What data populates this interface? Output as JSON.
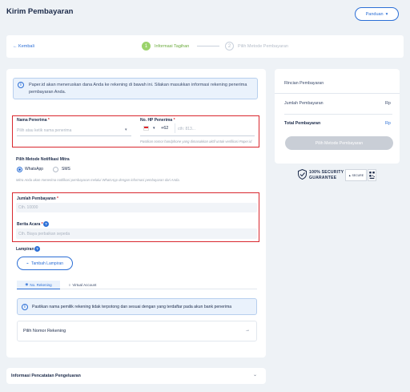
{
  "header": {
    "title": "Kirim Pembayaran",
    "guide_label": "Panduan"
  },
  "stepper": {
    "back_label": "Kembali",
    "steps": [
      {
        "number": "1",
        "label": "Informasi Tagihan"
      },
      {
        "number": "2",
        "label": "Pilih Metode Pembayaran"
      }
    ]
  },
  "info_banner": {
    "text": "Paper.id akan meneruskan dana Anda ke rekening di bawah ini. Silakan masukkan informasi rekening penerima pembayaran Anda."
  },
  "recipient": {
    "name_label": "Nama Penerima",
    "name_placeholder": "Pilih atau ketik nama penerima",
    "phone_label": "No. HP Penerima",
    "country_code": "+62",
    "phone_placeholder": "cth: 813...",
    "phone_hint": "Pastikan nomor handphone yang dimasukkan aktif untuk verifikasi Paper.id"
  },
  "notification": {
    "label": "Pilih Metode Notifikasi Mitra",
    "options": [
      "WhatsApp",
      "SMS"
    ],
    "selected": "WhatsApp",
    "hint": "Mitra Anda akan menerima notifikasi pembayaran melalui WhatsApp dengan informasi pembayaran dari Anda."
  },
  "payment": {
    "amount_label": "Jumlah Pembayaran",
    "amount_placeholder": "Cth. 10000",
    "news_label": "Berita Acara",
    "news_placeholder": "Cth. Biaya perbaikan sepeda"
  },
  "attachment": {
    "label": "Lampiran",
    "button_label": "Tambah Lampiran"
  },
  "account_tabs": {
    "tabs": [
      "No. Rekening",
      "Virtual Account"
    ],
    "active": "No. Rekening"
  },
  "warning": {
    "text": "Pastikan nama pemilik rekening tidak terpotong dan sesuai dengan yang terdaftar pada akun bank penerima"
  },
  "select_account": {
    "label": "Pilih Nomor Rekening"
  },
  "expense": {
    "label": "Informasi Pencatatan Pengeluaran"
  },
  "summary": {
    "title": "Rincian Pembayaran",
    "amount_label": "Jumlah Pembayaran",
    "amount_value": "Rp",
    "total_label": "Total Pembayaran",
    "total_value": "Rp",
    "pay_button": "Pilih Metode Pembayaran"
  },
  "security": {
    "badge_line1": "100% SECURITY",
    "badge_line2": "GUARANTEE",
    "secure_text": "SECURE"
  },
  "colors": {
    "accent": "#2c6fd6",
    "step_active": "#9bd36b",
    "highlight_border": "#d9282f",
    "page_bg": "#eef2f6"
  }
}
